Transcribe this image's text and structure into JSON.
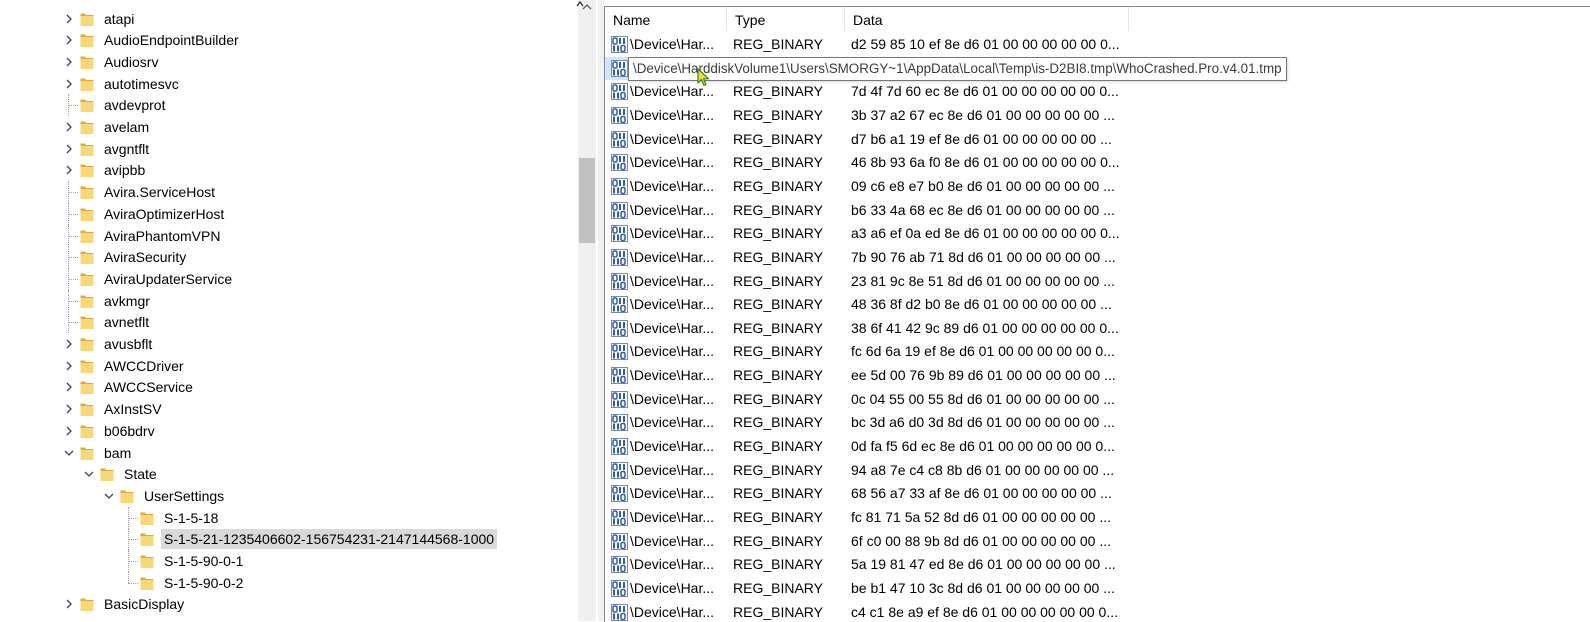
{
  "tree": {
    "items": [
      {
        "label": "atapi",
        "depth": 0,
        "expander": "collapsed"
      },
      {
        "label": "AudioEndpointBuilder",
        "depth": 0,
        "expander": "collapsed"
      },
      {
        "label": "Audiosrv",
        "depth": 0,
        "expander": "collapsed"
      },
      {
        "label": "autotimesvc",
        "depth": 0,
        "expander": "collapsed"
      },
      {
        "label": "avdevprot",
        "depth": 0,
        "expander": "none"
      },
      {
        "label": "avelam",
        "depth": 0,
        "expander": "collapsed"
      },
      {
        "label": "avgntflt",
        "depth": 0,
        "expander": "collapsed"
      },
      {
        "label": "avipbb",
        "depth": 0,
        "expander": "collapsed"
      },
      {
        "label": "Avira.ServiceHost",
        "depth": 0,
        "expander": "none"
      },
      {
        "label": "AviraOptimizerHost",
        "depth": 0,
        "expander": "none"
      },
      {
        "label": "AviraPhantomVPN",
        "depth": 0,
        "expander": "none"
      },
      {
        "label": "AviraSecurity",
        "depth": 0,
        "expander": "none"
      },
      {
        "label": "AviraUpdaterService",
        "depth": 0,
        "expander": "none"
      },
      {
        "label": "avkmgr",
        "depth": 0,
        "expander": "none"
      },
      {
        "label": "avnetflt",
        "depth": 0,
        "expander": "none"
      },
      {
        "label": "avusbflt",
        "depth": 0,
        "expander": "collapsed"
      },
      {
        "label": "AWCCDriver",
        "depth": 0,
        "expander": "collapsed"
      },
      {
        "label": "AWCCService",
        "depth": 0,
        "expander": "collapsed"
      },
      {
        "label": "AxInstSV",
        "depth": 0,
        "expander": "collapsed"
      },
      {
        "label": "b06bdrv",
        "depth": 0,
        "expander": "collapsed"
      },
      {
        "label": "bam",
        "depth": 0,
        "expander": "expanded"
      },
      {
        "label": "State",
        "depth": 1,
        "expander": "expanded"
      },
      {
        "label": "UserSettings",
        "depth": 2,
        "expander": "expanded"
      },
      {
        "label": "S-1-5-18",
        "depth": 3,
        "expander": "none"
      },
      {
        "label": "S-1-5-21-1235406602-156754231-2147144568-1000",
        "depth": 3,
        "expander": "none",
        "selected": true
      },
      {
        "label": "S-1-5-90-0-1",
        "depth": 3,
        "expander": "none"
      },
      {
        "label": "S-1-5-90-0-2",
        "depth": 3,
        "expander": "none"
      },
      {
        "label": "BasicDisplay",
        "depth": 0,
        "expander": "collapsed"
      }
    ]
  },
  "list": {
    "columns": [
      "Name",
      "Type",
      "Data"
    ],
    "rows": [
      {
        "name": "\\Device\\Har...",
        "type": "REG_BINARY",
        "data": "d2 59 85 10 ef 8e d6 01 00 00 00 00 00 0..."
      },
      {
        "name": "\\Device\\Har...",
        "type": "REG_BINARY",
        "data": ""
      },
      {
        "name": "\\Device\\Har...",
        "type": "REG_BINARY",
        "data": "7d 4f 7d 60 ec 8e d6 01 00 00 00 00 00 0..."
      },
      {
        "name": "\\Device\\Har...",
        "type": "REG_BINARY",
        "data": "3b 37 a2 67 ec 8e d6 01 00 00 00 00 00 ..."
      },
      {
        "name": "\\Device\\Har...",
        "type": "REG_BINARY",
        "data": "d7 b6 a1 19 ef 8e d6 01 00 00 00 00 00 ..."
      },
      {
        "name": "\\Device\\Har...",
        "type": "REG_BINARY",
        "data": "46 8b 93 6a f0 8e d6 01 00 00 00 00 00 0..."
      },
      {
        "name": "\\Device\\Har...",
        "type": "REG_BINARY",
        "data": "09 c6 e8 e7 b0 8e d6 01 00 00 00 00 00 ..."
      },
      {
        "name": "\\Device\\Har...",
        "type": "REG_BINARY",
        "data": "b6 33 4a 68 ec 8e d6 01 00 00 00 00 00 ..."
      },
      {
        "name": "\\Device\\Har...",
        "type": "REG_BINARY",
        "data": "a3 a6 ef 0a ed 8e d6 01 00 00 00 00 00 0..."
      },
      {
        "name": "\\Device\\Har...",
        "type": "REG_BINARY",
        "data": "7b 90 76 ab 71 8d d6 01 00 00 00 00 00 ..."
      },
      {
        "name": "\\Device\\Har...",
        "type": "REG_BINARY",
        "data": "23 81 9c 8e 51 8d d6 01 00 00 00 00 00 ..."
      },
      {
        "name": "\\Device\\Har...",
        "type": "REG_BINARY",
        "data": "48 36 8f d2 b0 8e d6 01 00 00 00 00 00 ..."
      },
      {
        "name": "\\Device\\Har...",
        "type": "REG_BINARY",
        "data": "38 6f 41 42 9c 89 d6 01 00 00 00 00 00 0..."
      },
      {
        "name": "\\Device\\Har...",
        "type": "REG_BINARY",
        "data": "fc 6d 6a 19 ef 8e d6 01 00 00 00 00 00 0..."
      },
      {
        "name": "\\Device\\Har...",
        "type": "REG_BINARY",
        "data": "ee 5d 00 76 9b 89 d6 01 00 00 00 00 00 ..."
      },
      {
        "name": "\\Device\\Har...",
        "type": "REG_BINARY",
        "data": "0c 04 55 00 55 8d d6 01 00 00 00 00 00 ..."
      },
      {
        "name": "\\Device\\Har...",
        "type": "REG_BINARY",
        "data": "bc 3d a6 d0 3d 8d d6 01 00 00 00 00 00 ..."
      },
      {
        "name": "\\Device\\Har...",
        "type": "REG_BINARY",
        "data": "0d fa f5 6d ec 8e d6 01 00 00 00 00 00 0..."
      },
      {
        "name": "\\Device\\Har...",
        "type": "REG_BINARY",
        "data": "94 a8 7e c4 c8 8b d6 01 00 00 00 00 00 ..."
      },
      {
        "name": "\\Device\\Har...",
        "type": "REG_BINARY",
        "data": "68 56 a7 33 af 8e d6 01 00 00 00 00 00 ..."
      },
      {
        "name": "\\Device\\Har...",
        "type": "REG_BINARY",
        "data": "fc 81 71 5a 52 8d d6 01 00 00 00 00 00 ..."
      },
      {
        "name": "\\Device\\Har...",
        "type": "REG_BINARY",
        "data": "6f c0 00 88 9b 8d d6 01 00 00 00 00 00 ..."
      },
      {
        "name": "\\Device\\Har...",
        "type": "REG_BINARY",
        "data": "5a 19 81 47 ed 8e d6 01 00 00 00 00 00 ..."
      },
      {
        "name": "\\Device\\Har...",
        "type": "REG_BINARY",
        "data": "be b1 47 10 3c 8d d6 01 00 00 00 00 00 ..."
      },
      {
        "name": "\\Device\\Har...",
        "type": "REG_BINARY",
        "data": "c4 c1 8e a9 ef 8e d6 01 00 00 00 00 00 0..."
      }
    ]
  },
  "tooltip": {
    "text": "\\Device\\HarddiskVolume1\\Users\\SMORGY~1\\AppData\\Local\\Temp\\is-D2BI8.tmp\\WhoCrashed.Pro.v4.01.tmp"
  },
  "icons": {
    "folder": "folder-icon",
    "registry_value": "reg-binary-icon",
    "expander_collapsed": "chevron-right-icon",
    "expander_expanded": "chevron-down-icon",
    "cursor": "mouse-pointer-icon"
  },
  "colors": {
    "folder_fill": "#f8d775",
    "folder_dark": "#e0a93a",
    "selection": "#d9d9d9",
    "tooltip_border": "#767676",
    "reg_icon_blue": "#2d5bb5"
  }
}
